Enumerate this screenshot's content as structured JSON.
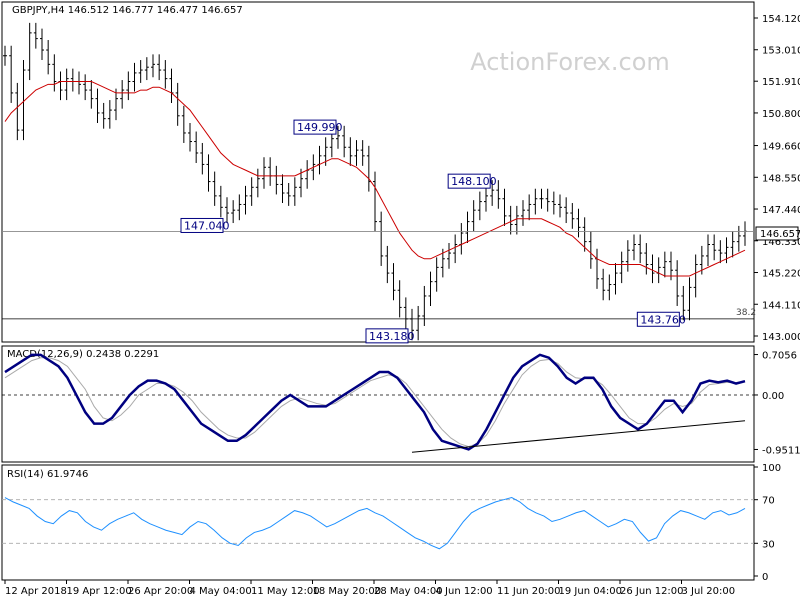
{
  "chart_data": [
    {
      "type": "candlestick",
      "header": "GBPJPY,H4  146.512 146.777 146.477 146.657",
      "symbol": "GBPJPY",
      "timeframe": "H4",
      "ohlc_last": [
        146.512,
        146.777,
        146.477,
        146.657
      ],
      "watermark": "ActionForex.com",
      "ylim": [
        143.0,
        154.4
      ],
      "y_ticks": [
        "154.120",
        "153.010",
        "151.910",
        "150.800",
        "149.660",
        "148.550",
        "147.440",
        "146.330",
        "145.220",
        "144.110",
        "143.000"
      ],
      "last_price_label": "146.657",
      "ma_color": "#cc0000",
      "price_color": "#000000",
      "price_close": [
        152.8,
        151.5,
        150.2,
        152.3,
        153.6,
        153.4,
        153.0,
        152.5,
        151.9,
        151.6,
        152.0,
        151.9,
        151.8,
        151.6,
        151.3,
        150.8,
        150.6,
        150.9,
        151.3,
        151.6,
        151.9,
        152.2,
        152.3,
        152.4,
        152.5,
        152.3,
        152.0,
        151.5,
        150.7,
        150.1,
        149.8,
        149.4,
        149.0,
        148.4,
        147.9,
        147.5,
        147.3,
        147.4,
        147.6,
        147.9,
        148.2,
        148.5,
        148.9,
        148.6,
        148.3,
        148.0,
        147.9,
        148.2,
        148.5,
        148.8,
        149.0,
        149.3,
        149.6,
        149.9,
        150.0,
        149.6,
        149.3,
        149.5,
        149.3,
        148.4,
        147.0,
        145.8,
        145.2,
        144.6,
        144.0,
        143.6,
        143.2,
        143.7,
        144.4,
        144.9,
        145.4,
        145.7,
        145.9,
        146.2,
        146.6,
        147.0,
        147.4,
        147.7,
        147.9,
        148.1,
        147.8,
        147.2,
        146.9,
        147.2,
        147.4,
        147.6,
        147.8,
        147.8,
        147.7,
        147.6,
        147.5,
        147.3,
        147.1,
        146.8,
        146.3,
        145.7,
        145.0,
        144.6,
        144.8,
        145.2,
        145.6,
        146.0,
        146.2,
        145.9,
        145.5,
        145.2,
        145.4,
        145.6,
        145.3,
        144.4,
        143.9,
        144.7,
        145.5,
        145.8,
        146.2,
        146.0,
        145.9,
        146.1,
        146.3,
        146.5,
        146.66
      ],
      "ma_values": [
        150.5,
        150.8,
        151.0,
        151.2,
        151.4,
        151.6,
        151.7,
        151.8,
        151.8,
        151.9,
        151.9,
        151.9,
        151.9,
        151.9,
        151.9,
        151.8,
        151.7,
        151.6,
        151.5,
        151.5,
        151.5,
        151.5,
        151.6,
        151.6,
        151.7,
        151.7,
        151.6,
        151.5,
        151.3,
        151.1,
        150.9,
        150.6,
        150.3,
        150.0,
        149.7,
        149.4,
        149.2,
        149.0,
        148.9,
        148.8,
        148.7,
        148.6,
        148.6,
        148.6,
        148.6,
        148.6,
        148.6,
        148.6,
        148.7,
        148.8,
        148.9,
        149.0,
        149.1,
        149.2,
        149.2,
        149.1,
        149.0,
        148.9,
        148.7,
        148.5,
        148.2,
        147.8,
        147.4,
        147.0,
        146.6,
        146.3,
        146.0,
        145.8,
        145.7,
        145.7,
        145.8,
        145.9,
        146.0,
        146.1,
        146.2,
        146.3,
        146.4,
        146.5,
        146.6,
        146.7,
        146.8,
        146.9,
        147.0,
        147.1,
        147.1,
        147.1,
        147.1,
        147.1,
        147.0,
        146.9,
        146.8,
        146.6,
        146.5,
        146.3,
        146.1,
        145.9,
        145.7,
        145.6,
        145.5,
        145.5,
        145.5,
        145.5,
        145.5,
        145.5,
        145.4,
        145.3,
        145.2,
        145.1,
        145.1,
        145.1,
        145.1,
        145.1,
        145.2,
        145.3,
        145.4,
        145.5,
        145.6,
        145.7,
        145.8,
        145.9,
        146.0
      ],
      "annotations": [
        {
          "label": "149.990",
          "value": 149.99,
          "bar": 54
        },
        {
          "label": "147.040",
          "value": 147.04,
          "bar": 36
        },
        {
          "label": "148.100",
          "value": 148.1,
          "bar": 79
        },
        {
          "label": "143.180",
          "value": 143.18,
          "bar": 66
        },
        {
          "label": "143.760",
          "value": 143.76,
          "bar": 110
        }
      ],
      "fib_level": {
        "label": "38.2",
        "value": 143.6
      },
      "hline_value": 146.657
    },
    {
      "type": "line",
      "header": "MACD(12,26,9) 0.2438 0.2291",
      "ylim": [
        -1.1,
        0.75
      ],
      "y_ticks": [
        "0.7056",
        "0.00",
        "-0.9511"
      ],
      "macd_color": "#000080",
      "signal_color": "#aaaaaa",
      "macd": [
        0.4,
        0.5,
        0.6,
        0.7,
        0.7,
        0.6,
        0.5,
        0.3,
        0.0,
        -0.3,
        -0.5,
        -0.5,
        -0.4,
        -0.2,
        0.0,
        0.15,
        0.25,
        0.25,
        0.2,
        0.1,
        -0.1,
        -0.3,
        -0.5,
        -0.6,
        -0.7,
        -0.8,
        -0.8,
        -0.7,
        -0.55,
        -0.4,
        -0.25,
        -0.1,
        0.0,
        -0.1,
        -0.2,
        -0.2,
        -0.2,
        -0.1,
        0.0,
        0.1,
        0.2,
        0.3,
        0.4,
        0.4,
        0.3,
        0.1,
        -0.1,
        -0.3,
        -0.6,
        -0.8,
        -0.85,
        -0.9,
        -0.95,
        -0.85,
        -0.6,
        -0.3,
        0.0,
        0.3,
        0.5,
        0.6,
        0.7,
        0.65,
        0.5,
        0.3,
        0.2,
        0.3,
        0.3,
        0.1,
        -0.2,
        -0.4,
        -0.5,
        -0.6,
        -0.5,
        -0.3,
        -0.1,
        -0.1,
        -0.3,
        -0.1,
        0.2,
        0.25,
        0.22,
        0.25,
        0.2,
        0.24
      ],
      "signal": [
        0.3,
        0.4,
        0.5,
        0.6,
        0.65,
        0.65,
        0.6,
        0.5,
        0.3,
        0.1,
        -0.2,
        -0.4,
        -0.45,
        -0.35,
        -0.2,
        0.0,
        0.1,
        0.2,
        0.2,
        0.15,
        0.05,
        -0.1,
        -0.3,
        -0.45,
        -0.6,
        -0.7,
        -0.75,
        -0.75,
        -0.65,
        -0.5,
        -0.35,
        -0.2,
        -0.1,
        -0.05,
        -0.1,
        -0.15,
        -0.18,
        -0.15,
        -0.05,
        0.05,
        0.15,
        0.25,
        0.3,
        0.35,
        0.32,
        0.2,
        0.0,
        -0.2,
        -0.4,
        -0.6,
        -0.75,
        -0.85,
        -0.9,
        -0.85,
        -0.7,
        -0.45,
        -0.15,
        0.1,
        0.35,
        0.5,
        0.6,
        0.62,
        0.55,
        0.4,
        0.3,
        0.28,
        0.28,
        0.18,
        0.0,
        -0.2,
        -0.4,
        -0.5,
        -0.5,
        -0.4,
        -0.25,
        -0.15,
        -0.2,
        -0.15,
        0.05,
        0.18,
        0.2,
        0.22,
        0.21,
        0.23
      ],
      "trendline": [
        [
          66,
          -1.0
        ],
        [
          120,
          -0.45
        ]
      ]
    },
    {
      "type": "line",
      "header": "RSI(14) 61.9746",
      "ylim": [
        0,
        100
      ],
      "y_ticks": [
        "100",
        "70",
        "30",
        "0"
      ],
      "rsi_color": "#1e90ff",
      "rsi": [
        72,
        68,
        65,
        62,
        55,
        50,
        48,
        55,
        60,
        58,
        50,
        45,
        42,
        48,
        52,
        55,
        58,
        52,
        48,
        45,
        42,
        40,
        38,
        45,
        50,
        48,
        42,
        35,
        30,
        28,
        35,
        40,
        42,
        45,
        50,
        55,
        60,
        58,
        55,
        50,
        45,
        48,
        52,
        56,
        60,
        62,
        58,
        55,
        50,
        45,
        40,
        35,
        32,
        28,
        25,
        30,
        40,
        50,
        58,
        62,
        65,
        68,
        70,
        72,
        68,
        62,
        58,
        55,
        50,
        52,
        55,
        58,
        60,
        55,
        50,
        45,
        48,
        52,
        50,
        40,
        32,
        35,
        48,
        55,
        60,
        58,
        55,
        52,
        58,
        60,
        56,
        58,
        62
      ]
    }
  ],
  "x_ticks": [
    "12 Apr 2018",
    "19 Apr 12:00",
    "26 Apr 20:00",
    "4 May 04:00",
    "11 May 12:00",
    "18 May 20:00",
    "28 May 04:00",
    "4 Jun 12:00",
    "11 Jun 20:00",
    "19 Jun 04:00",
    "26 Jun 12:00",
    "3 Jul 20:00"
  ]
}
